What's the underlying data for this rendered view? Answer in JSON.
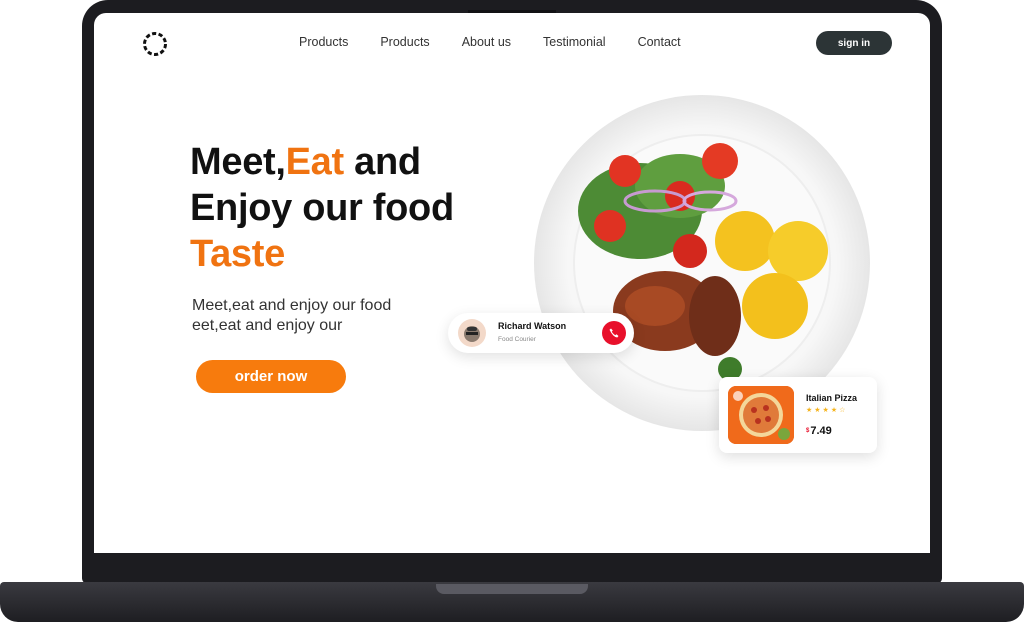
{
  "nav": {
    "links": [
      "Products",
      "Products",
      "About us",
      "Testimonial",
      "Contact"
    ],
    "signin_label": "sign in"
  },
  "hero": {
    "title_part1": "Meet,",
    "title_accent1": "Eat",
    "title_part2": " and",
    "title_line2": "Enjoy our food",
    "title_line3": "Taste",
    "subtitle_line1": "Meet,eat  and enjoy our food",
    "subtitle_line2": "eet,eat  and enjoy our",
    "cta_label": "order now"
  },
  "courier": {
    "name": "Richard Watson",
    "role": "Food Courier"
  },
  "product": {
    "name": "Italian Pizza",
    "rating": 4,
    "stars": "★★★★☆",
    "currency": "$",
    "price": "7.49"
  },
  "colors": {
    "accent": "#f07311",
    "button": "#f77b0d",
    "signin_bg": "#2c3436",
    "call": "#e8102b"
  }
}
